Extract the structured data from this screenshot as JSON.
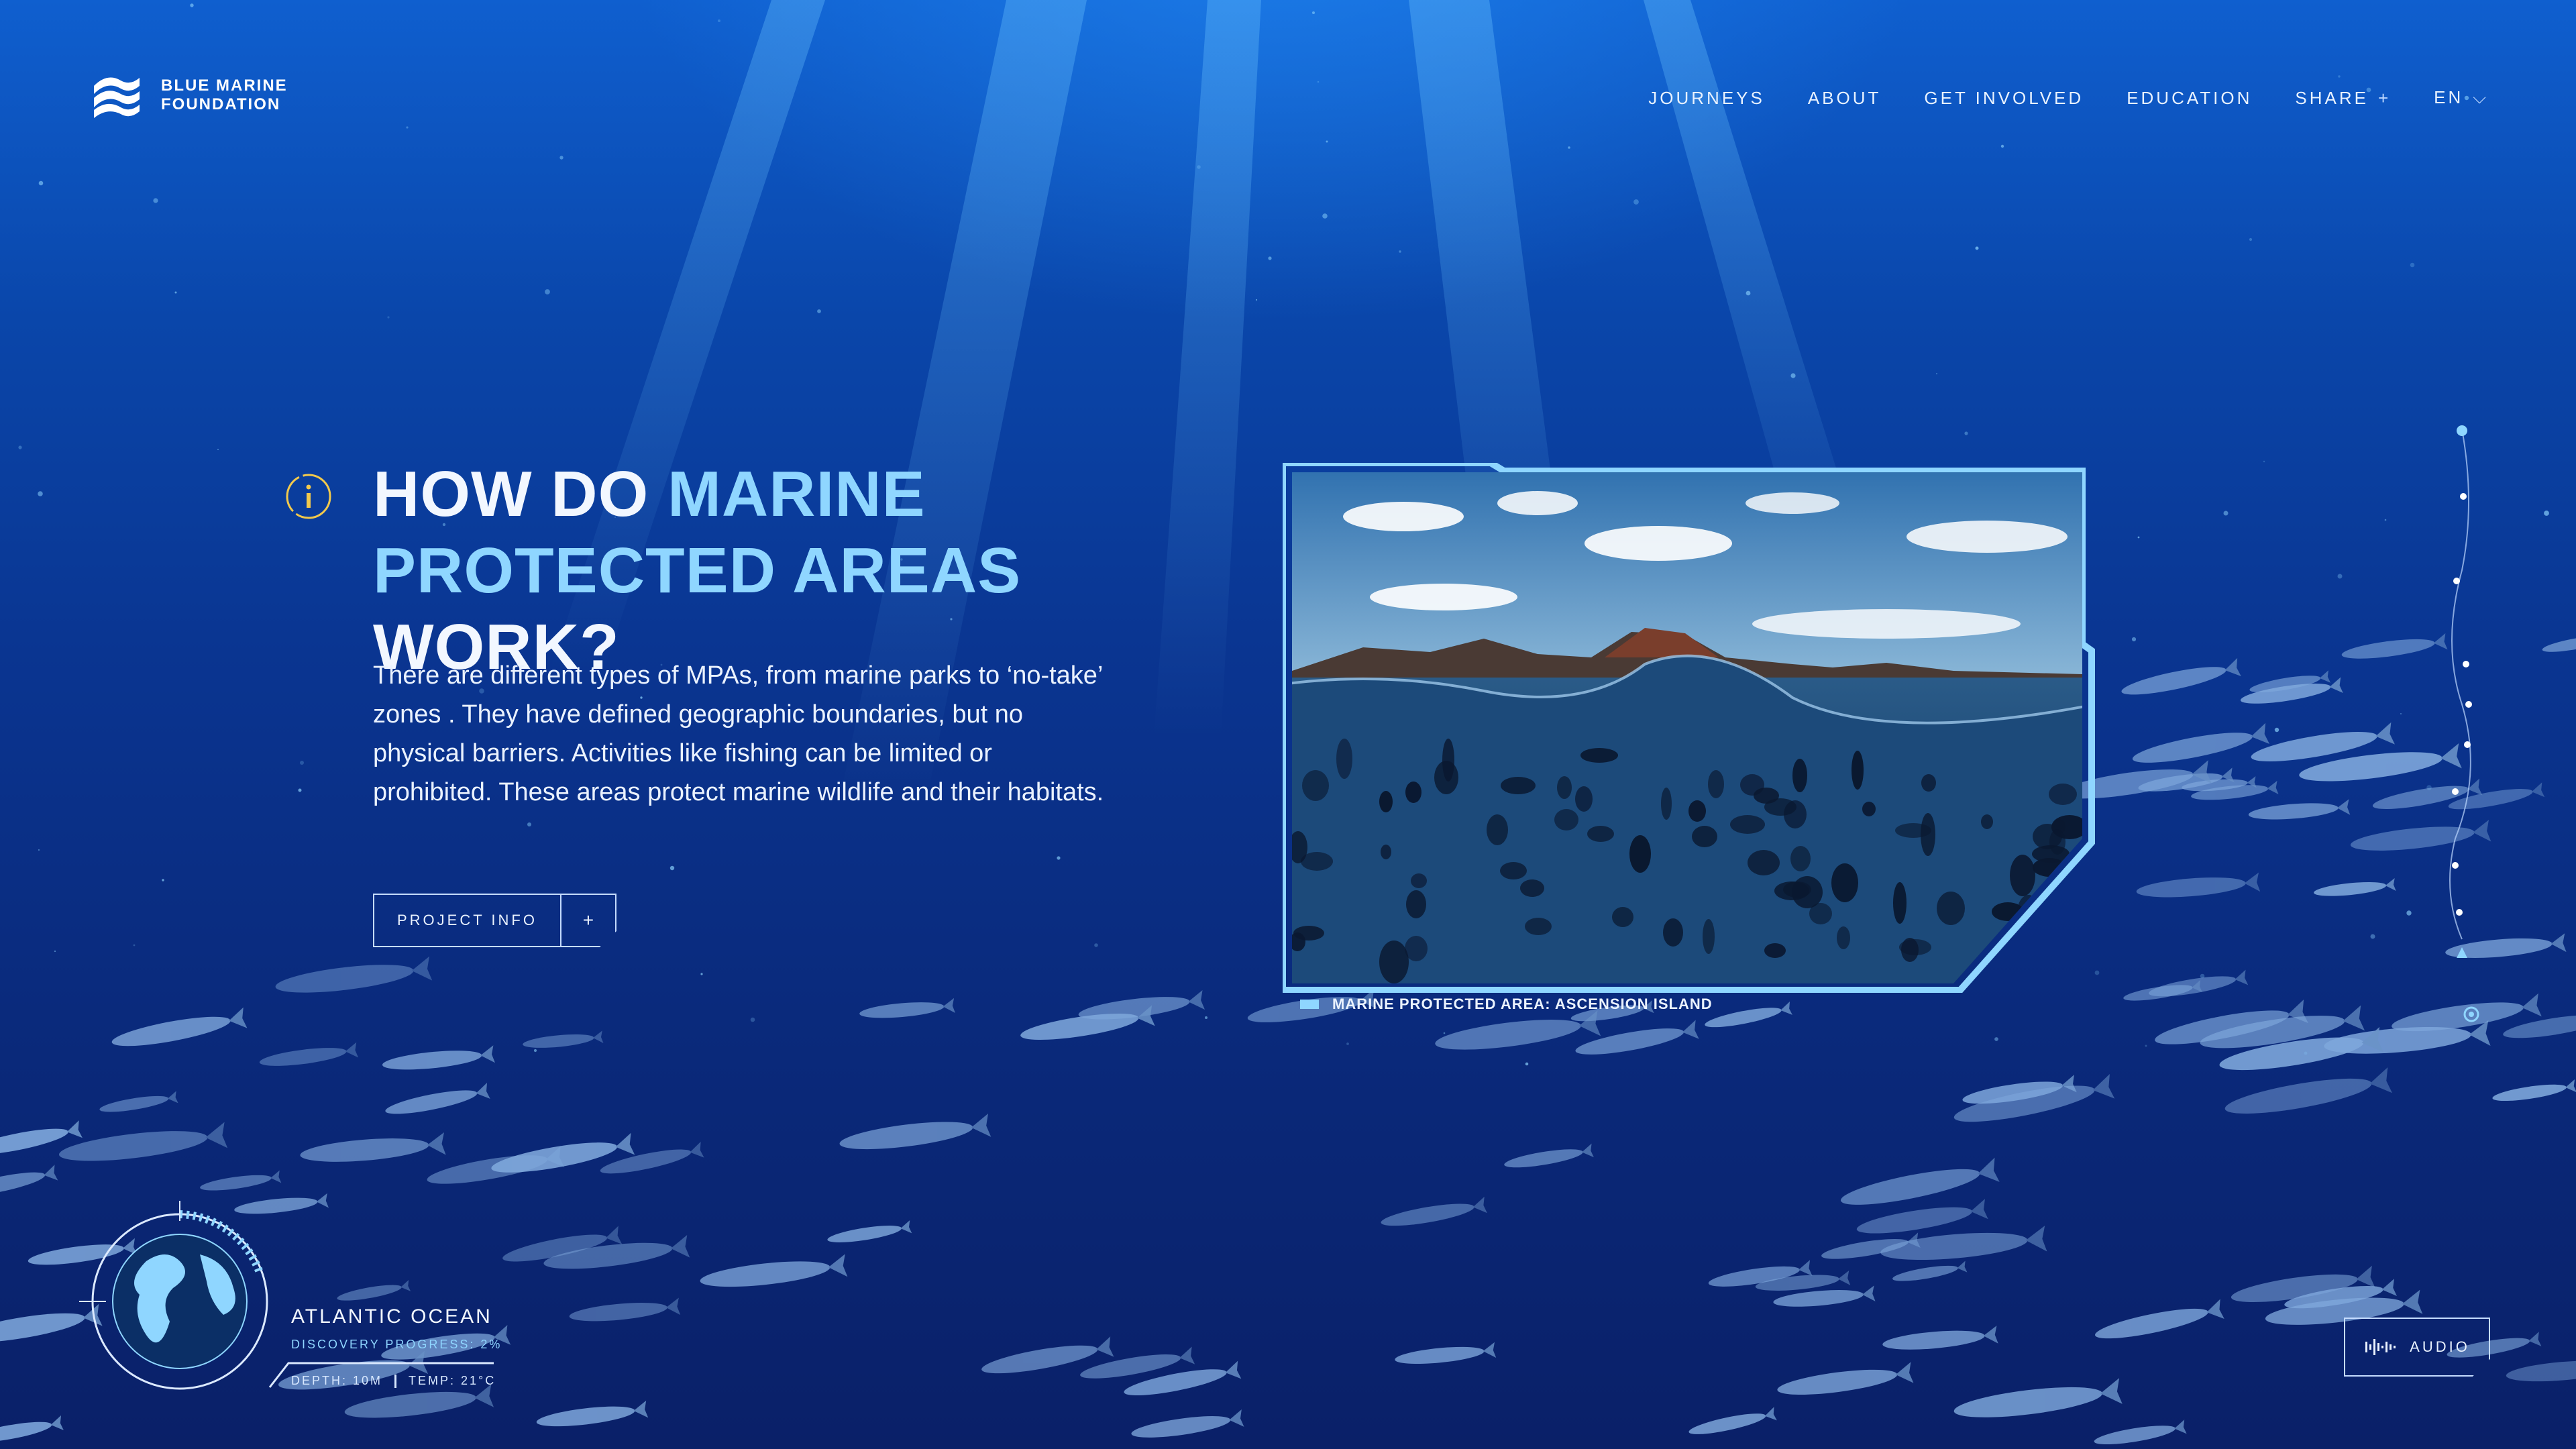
{
  "brand": {
    "line1": "BLUE MARINE",
    "line2": "FOUNDATION"
  },
  "nav": {
    "journeys": "JOURNEYS",
    "about": "ABOUT",
    "get_involved": "GET INVOLVED",
    "education": "EDUCATION",
    "share": "SHARE",
    "share_glyph": "+",
    "language": "EN",
    "language_glyph": "⌵"
  },
  "hero": {
    "title_part1": "HOW DO ",
    "title_highlight1": "MARINE",
    "title_highlight2": "PROTECTED AREAS",
    "title_part2": " WORK?",
    "body": "There are different types of MPAs, from marine parks to ‘no-take’ zones . They have defined geographic boundaries, but no physical barriers. Activities like fishing can be limited or prohibited. These areas protect marine wildlife and their habitats.",
    "button_label": "PROJECT INFO",
    "button_glyph": "+"
  },
  "media": {
    "caption": "MARINE PROTECTED AREA: ASCENSION ISLAND"
  },
  "location": {
    "name": "ATLANTIC OCEAN",
    "progress": "DISCOVERY PROGRESS: 2%",
    "depth": "DEPTH: 10M",
    "temp": "TEMP: 21°C"
  },
  "audio": {
    "label": "AUDIO"
  },
  "colors": {
    "accent": "#8fd6ff",
    "info_icon": "#f2c94c",
    "deep": "#0a2068"
  }
}
